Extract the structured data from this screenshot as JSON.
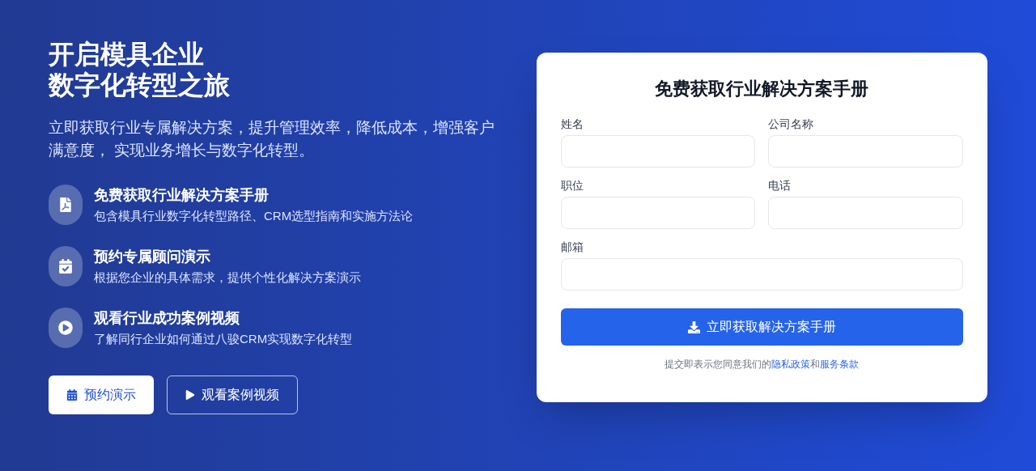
{
  "hero": {
    "title_lines": [
      "开启模具企业",
      "数字化转型之旅"
    ],
    "subtitle": "立即获取行业专属解决方案，提升管理效率，降低成本，增强客户满意度， 实现业务增长与数字化转型。"
  },
  "features": [
    {
      "kind": "pdf",
      "title": "免费获取行业解决方案手册",
      "description": "包含模具行业数字化转型路径、CRM选型指南和实施方法论"
    },
    {
      "kind": "calendar",
      "title": "预约专属顾问演示",
      "description": "根据您企业的具体需求，提供个性化解决方案演示"
    },
    {
      "kind": "play",
      "title": "观看行业成功案例视频",
      "description": "了解同行企业如何通过八骏CRM实现数字化转型"
    }
  ],
  "actions": [
    {
      "kind": "primary",
      "label": "预约演示"
    },
    {
      "kind": "outline",
      "label": "观看案例视频"
    }
  ],
  "form": {
    "title": "免费获取行业解决方案手册",
    "fields": [
      {
        "label": "姓名",
        "kind": "half"
      },
      {
        "label": "公司名称",
        "kind": "half"
      },
      {
        "label": "职位",
        "kind": "half"
      },
      {
        "label": "电话",
        "kind": "half"
      },
      {
        "label": "邮箱",
        "kind": "full"
      }
    ],
    "submit": "立即获取解决方案手册",
    "consent": {
      "before": "提交即表示您同意我们的",
      "privacy_link": "隐私政策",
      "joiner": "和",
      "terms_link": "服务条款"
    }
  }
}
